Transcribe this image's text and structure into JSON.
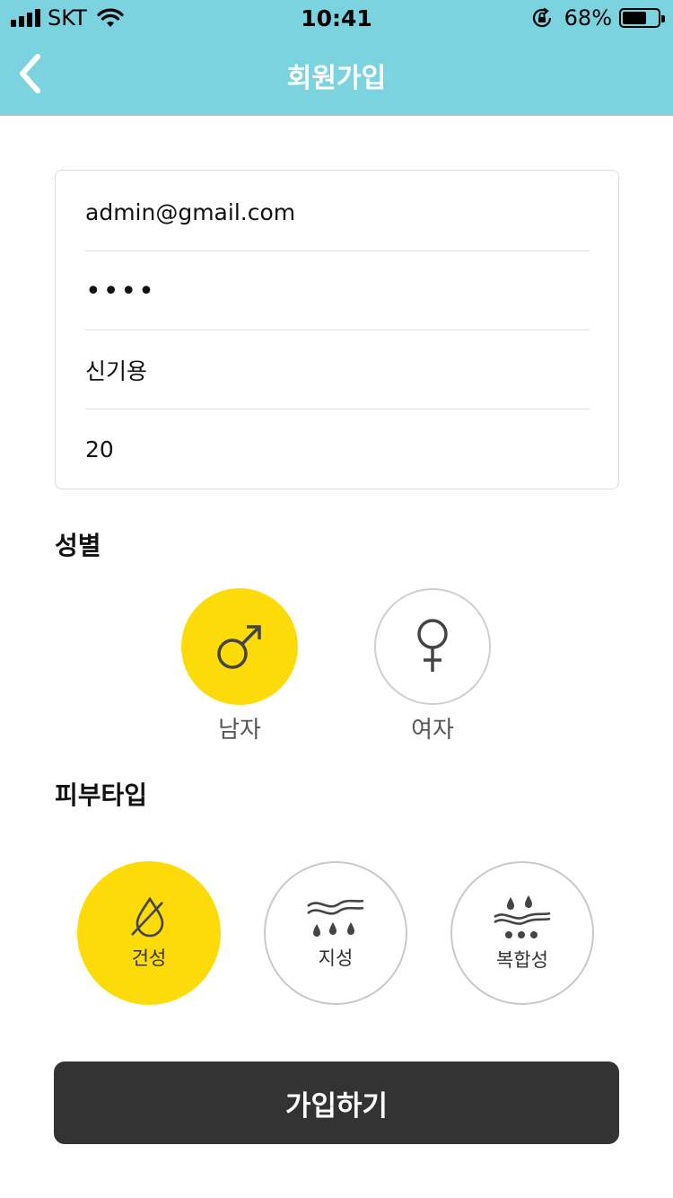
{
  "status_bar": {
    "carrier": "SKT",
    "time": "10:41",
    "battery": "68%",
    "battery_level": 0.68
  },
  "nav": {
    "title": "회원가입"
  },
  "form": {
    "email": "admin@gmail.com",
    "password_mask": "••••",
    "name": "신기용",
    "age": "20"
  },
  "gender": {
    "label": "성별",
    "options": [
      {
        "label": "남자",
        "selected": true
      },
      {
        "label": "여자",
        "selected": false
      }
    ]
  },
  "skin": {
    "label": "피부타입",
    "options": [
      {
        "label": "건성",
        "selected": true
      },
      {
        "label": "지성",
        "selected": false
      },
      {
        "label": "복합성",
        "selected": false
      }
    ]
  },
  "submit": {
    "label": "가입하기"
  },
  "colors": {
    "header": "#7bd3e0",
    "accent": "#fcdb09",
    "button": "#333333"
  }
}
